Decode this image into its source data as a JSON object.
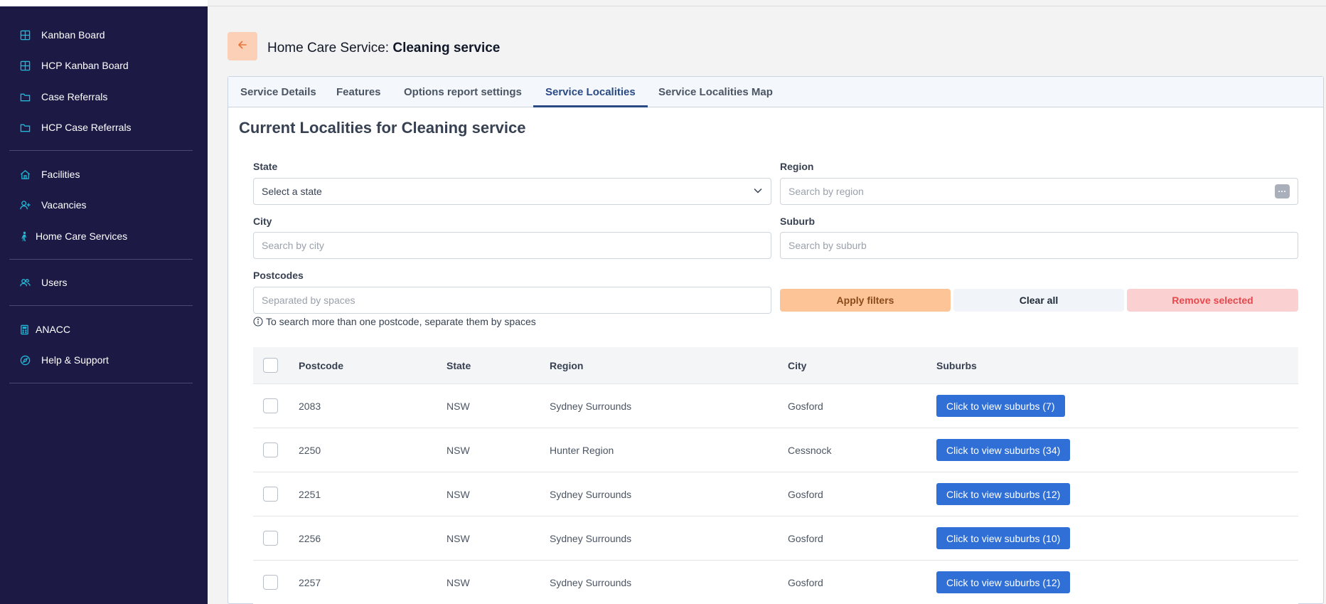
{
  "sidebar": {
    "items": [
      {
        "label": "Kanban Board",
        "icon": "grid-icon"
      },
      {
        "label": "HCP Kanban Board",
        "icon": "grid-icon"
      },
      {
        "label": "Case Referrals",
        "icon": "folder-icon"
      },
      {
        "label": "HCP Case Referrals",
        "icon": "folder-icon"
      },
      {
        "label": "Facilities",
        "icon": "home-icon"
      },
      {
        "label": "Vacancies",
        "icon": "user-plus-icon"
      },
      {
        "label": "Home Care Services",
        "icon": "walking-person-icon"
      },
      {
        "label": "Users",
        "icon": "users-icon"
      },
      {
        "label": "ANACC",
        "icon": "calculator-icon"
      },
      {
        "label": "Help & Support",
        "icon": "compass-icon"
      }
    ]
  },
  "header": {
    "title_prefix": "Home Care Service: ",
    "title_name": "Cleaning service"
  },
  "tabs": [
    {
      "label": "Service Details"
    },
    {
      "label": "Features"
    },
    {
      "label": "Options report settings"
    },
    {
      "label": "Service Localities",
      "active": true
    },
    {
      "label": "Service Localities Map"
    }
  ],
  "section_title": "Current Localities for Cleaning service",
  "filters": {
    "state": {
      "label": "State",
      "value": "Select a state"
    },
    "region": {
      "label": "Region",
      "placeholder": "Search by region"
    },
    "city": {
      "label": "City",
      "placeholder": "Search by city"
    },
    "suburb": {
      "label": "Suburb",
      "placeholder": "Search by suburb"
    },
    "postcodes": {
      "label": "Postcodes",
      "placeholder": "Separated by spaces"
    },
    "hint": "To search more than one postcode, separate them by spaces",
    "apply_label": "Apply filters",
    "clear_label": "Clear all",
    "remove_label": "Remove selected"
  },
  "table": {
    "columns": [
      "Postcode",
      "State",
      "Region",
      "City",
      "Suburbs"
    ],
    "rows": [
      {
        "postcode": "2083",
        "state": "NSW",
        "region": "Sydney Surrounds",
        "city": "Gosford",
        "suburbs_label": "Click to view suburbs (7)"
      },
      {
        "postcode": "2250",
        "state": "NSW",
        "region": "Hunter Region",
        "city": "Cessnock",
        "suburbs_label": "Click to view suburbs (34)"
      },
      {
        "postcode": "2251",
        "state": "NSW",
        "region": "Sydney Surrounds",
        "city": "Gosford",
        "suburbs_label": "Click to view suburbs (12)"
      },
      {
        "postcode": "2256",
        "state": "NSW",
        "region": "Sydney Surrounds",
        "city": "Gosford",
        "suburbs_label": "Click to view suburbs (10)"
      },
      {
        "postcode": "2257",
        "state": "NSW",
        "region": "Sydney Surrounds",
        "city": "Gosford",
        "suburbs_label": "Click to view suburbs (12)"
      }
    ]
  },
  "colors": {
    "sidebar_bg": "#1c1a45",
    "icon_accent": "#22b8d6",
    "active_tab": "#2a4a86",
    "primary_button": "#2f6fd6",
    "apply_button": "#fcc497",
    "remove_button": "#fbd0d0",
    "back_button": "#fbd0b6"
  }
}
